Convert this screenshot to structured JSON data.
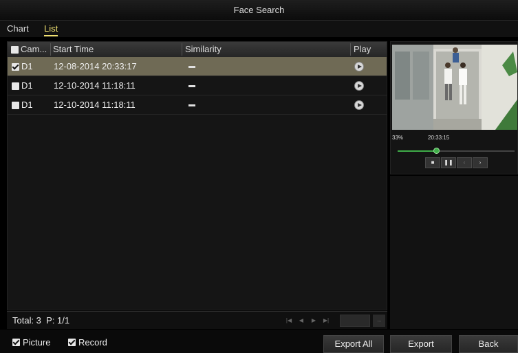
{
  "window": {
    "title": "Face Search"
  },
  "tabs": [
    {
      "label": "Chart"
    },
    {
      "label": "List"
    }
  ],
  "table": {
    "columns": [
      "Cam...",
      "Start Time",
      "Similarity",
      "Play"
    ],
    "rows": [
      {
        "camera": "D1",
        "start_time": "12-08-2014 20:33:17",
        "similarity": "",
        "checked": true,
        "selected": true
      },
      {
        "camera": "D1",
        "start_time": "12-10-2014 11:18:11",
        "similarity": "",
        "checked": false,
        "selected": false
      },
      {
        "camera": "D1",
        "start_time": "12-10-2014 11:18:11",
        "similarity": "",
        "checked": false,
        "selected": false
      }
    ]
  },
  "status": {
    "total_text": "Total: 3  P: 1/1"
  },
  "playback": {
    "percent": "33%",
    "time": "20:33:15",
    "progress": 0.33
  },
  "options": {
    "picture_label": "Picture",
    "record_label": "Record"
  },
  "buttons": {
    "export_all": "Export All",
    "export": "Export",
    "back": "Back"
  },
  "colors": {
    "accent": "#f0e070",
    "selected_row": "#6f6a55",
    "progress": "#3fae49"
  },
  "icons": {
    "play": "play-circle-icon",
    "stop": "stop-icon",
    "pause": "pause-icon",
    "prev": "chevron-left-icon",
    "next": "chevron-right-icon"
  }
}
